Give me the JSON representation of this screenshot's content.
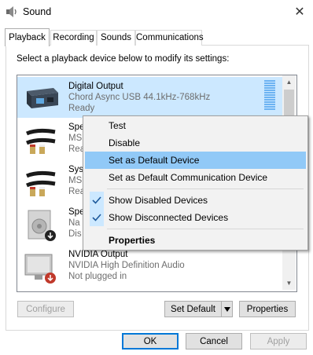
{
  "window": {
    "title": "Sound",
    "close_glyph": "✕"
  },
  "tabs": [
    {
      "label": "Playback",
      "active": true
    },
    {
      "label": "Recording",
      "active": false
    },
    {
      "label": "Sounds",
      "active": false
    },
    {
      "label": "Communications",
      "active": false
    }
  ],
  "instructions": "Select a playback device below to modify its settings:",
  "devices": [
    {
      "name": "Digital Output",
      "line1": "Chord Async USB 44.1kHz-768kHz",
      "line2": "Ready",
      "icon": "digital-output-icon",
      "selected": true
    },
    {
      "name": "Spe",
      "line1": "MS",
      "line2": "Rea",
      "icon": "rca-cable-icon",
      "selected": false
    },
    {
      "name": "Sys",
      "line1": "MS",
      "line2": "Rea",
      "icon": "rca-cable-icon",
      "selected": false
    },
    {
      "name": "Spe",
      "line1": "Na",
      "line2": "Dis",
      "icon": "speaker-disabled-icon",
      "selected": false
    },
    {
      "name": "NVIDIA Output",
      "line1": "NVIDIA High Definition Audio",
      "line2": "Not plugged in",
      "icon": "monitor-unplugged-icon",
      "selected": false
    }
  ],
  "buttons": {
    "configure": "Configure",
    "set_default": "Set Default",
    "properties": "Properties",
    "ok": "OK",
    "cancel": "Cancel",
    "apply": "Apply"
  },
  "context_menu": {
    "items": [
      {
        "label": "Test",
        "checked": false,
        "highlight": false,
        "bold": false
      },
      {
        "label": "Disable",
        "checked": false,
        "highlight": false,
        "bold": false
      },
      {
        "label": "Set as Default Device",
        "checked": false,
        "highlight": true,
        "bold": false
      },
      {
        "label": "Set as Default Communication Device",
        "checked": false,
        "highlight": false,
        "bold": false
      },
      {
        "label": "Show Disabled Devices",
        "checked": true,
        "highlight": false,
        "bold": false
      },
      {
        "label": "Show Disconnected Devices",
        "checked": true,
        "highlight": false,
        "bold": false
      },
      {
        "label": "Properties",
        "checked": false,
        "highlight": false,
        "bold": true
      }
    ]
  },
  "colors": {
    "selection": "#cce8ff",
    "menu_highlight": "#91c9f7",
    "accent": "#0078d7"
  }
}
